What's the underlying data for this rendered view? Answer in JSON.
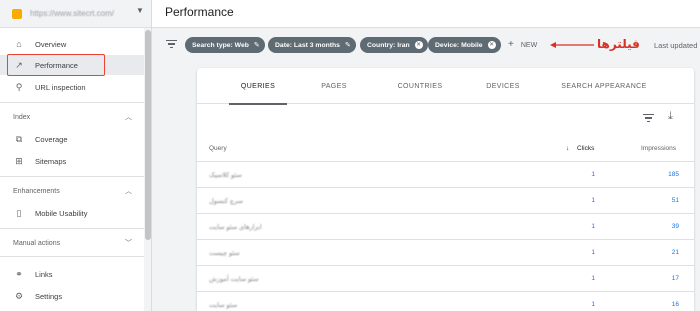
{
  "property": {
    "url": "https://www.sitecrt.com/"
  },
  "header": {
    "title": "Performance"
  },
  "sidebar": {
    "items": [
      {
        "label": "Overview",
        "icon": "home-icon",
        "glyph": "⌂"
      },
      {
        "label": "Performance",
        "icon": "trending-up-icon",
        "glyph": "↗"
      },
      {
        "label": "URL inspection",
        "icon": "search-icon",
        "glyph": "⚲"
      }
    ],
    "index_section": "Index",
    "index_items": [
      {
        "label": "Coverage",
        "icon": "coverage-icon",
        "glyph": "⧉"
      },
      {
        "label": "Sitemaps",
        "icon": "sitemap-icon",
        "glyph": "⊞"
      }
    ],
    "enhancements_section": "Enhancements",
    "enhancement_items": [
      {
        "label": "Mobile Usability",
        "icon": "phone-icon",
        "glyph": "▯"
      }
    ],
    "manual_actions_section": "Manual actions",
    "bottom_items": [
      {
        "label": "Links",
        "icon": "links-icon",
        "glyph": "⚭"
      },
      {
        "label": "Settings",
        "icon": "settings-icon",
        "glyph": "⚙"
      }
    ]
  },
  "filters": {
    "chips": [
      {
        "label": "Search type: Web",
        "action": "edit"
      },
      {
        "label": "Date: Last 3 months",
        "action": "edit"
      },
      {
        "label": "Country: Iran",
        "action": "remove"
      },
      {
        "label": "Device: Mobile",
        "action": "remove"
      }
    ],
    "new_label": "NEW",
    "annotation": "فیلترها",
    "last_updated": "Last updated"
  },
  "tabs": [
    "QUERIES",
    "PAGES",
    "COUNTRIES",
    "DEVICES",
    "SEARCH APPEARANCE"
  ],
  "table": {
    "headers": {
      "query": "Query",
      "clicks": "Clicks",
      "impressions": "Impressions"
    },
    "rows": [
      {
        "query": "سئو کلاسیک",
        "clicks": "1",
        "impressions": "185"
      },
      {
        "query": "سرچ کنسول",
        "clicks": "1",
        "impressions": "51"
      },
      {
        "query": "ابزارهای سئو سایت",
        "clicks": "1",
        "impressions": "39"
      },
      {
        "query": "سئو چیست",
        "clicks": "1",
        "impressions": "21"
      },
      {
        "query": "سئو سایت آموزش",
        "clicks": "1",
        "impressions": "17"
      },
      {
        "query": "سئو سایت",
        "clicks": "1",
        "impressions": "16"
      }
    ]
  },
  "colors": {
    "chip": "#5f6b73",
    "link": "#1a73e8",
    "highlight": "#ea4335",
    "annotation": "#d93025"
  }
}
